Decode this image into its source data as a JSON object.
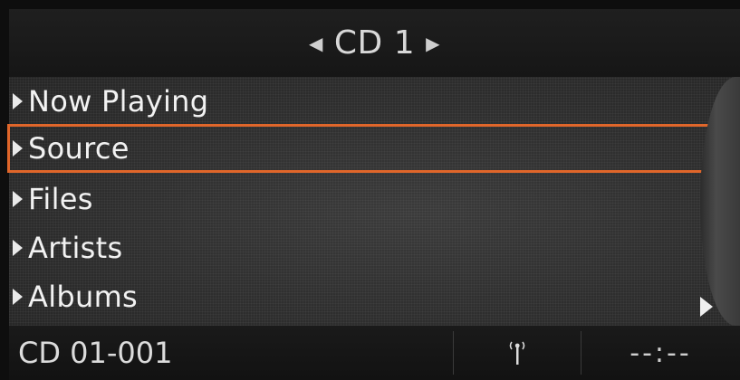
{
  "header": {
    "title": "CD 1",
    "prev_icon": "triangle-left-icon",
    "next_icon": "triangle-right-icon"
  },
  "menu": {
    "items": [
      {
        "label": "Now Playing",
        "selected": false
      },
      {
        "label": "Source",
        "selected": true
      },
      {
        "label": "Files",
        "selected": false
      },
      {
        "label": "Artists",
        "selected": false
      },
      {
        "label": "Albums",
        "selected": false
      }
    ],
    "more_icon": "triangle-right-icon"
  },
  "status": {
    "track": "CD 01-001",
    "antenna_icon": "antenna-icon",
    "time": "--:--"
  },
  "colors": {
    "selection": "#e0662a",
    "background": "#0e0e0e",
    "list_background": "#2e2e2e"
  }
}
